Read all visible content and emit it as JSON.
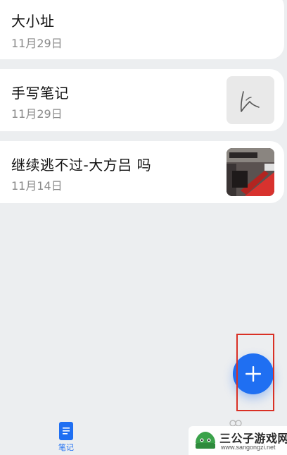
{
  "notes": [
    {
      "title": "大小址",
      "date": "11月29日"
    },
    {
      "title": "手写笔记",
      "date": "11月29日",
      "thumbnail": "handwriting-sketch"
    },
    {
      "title": "继续逃不过-大方吕 吗",
      "date": "11月14日",
      "thumbnail": "photo"
    }
  ],
  "fab": {
    "icon": "plus-icon"
  },
  "tabs": {
    "notes_label": "笔记",
    "notes_icon": "document-icon",
    "todo_icon": "todo-icon"
  },
  "watermark": {
    "text": "三公子游戏网",
    "url": "www.sangongzi.net"
  },
  "colors": {
    "background": "#eceef0",
    "accent": "#1f6ff2",
    "highlight": "#d93025",
    "card": "#ffffff"
  }
}
